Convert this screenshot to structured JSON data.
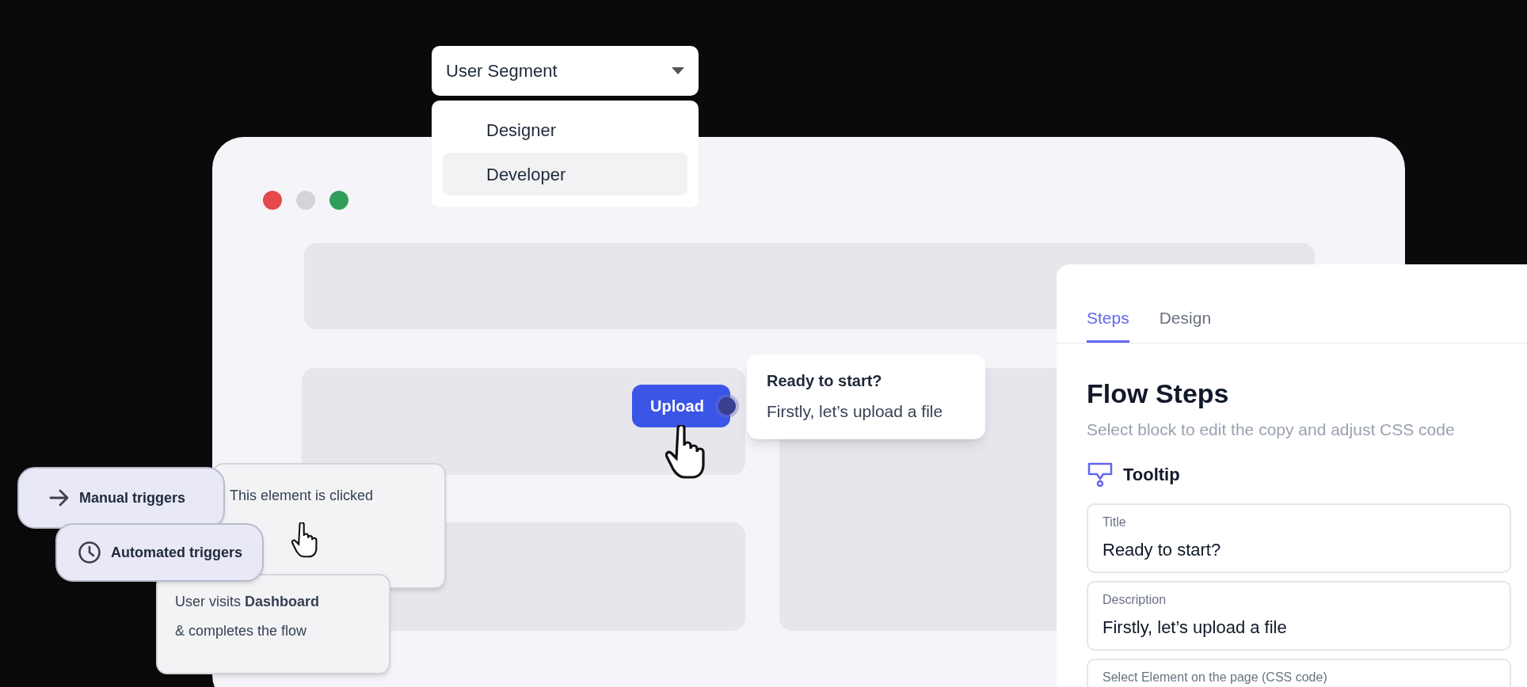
{
  "segment_dropdown": {
    "label": "User Segment",
    "options": [
      {
        "label": "Designer",
        "selected": false
      },
      {
        "label": "Developer",
        "selected": true
      }
    ]
  },
  "browser_window": {
    "controls": [
      {
        "color": "#e5484d"
      },
      {
        "color": "#d4d4d8"
      },
      {
        "color": "#2f9e5a"
      }
    ]
  },
  "upload_button": {
    "label": "Upload"
  },
  "tooltip": {
    "title": "Ready to start?",
    "description": "Firstly, let’s upload a file"
  },
  "trigger_cards": [
    {
      "lines": [
        "This element is clicked"
      ]
    },
    {
      "lines": [
        "User visits **Dashboard**",
        "& completes the flow"
      ]
    }
  ],
  "triggers": [
    {
      "kind": "manual",
      "label": "Manual triggers"
    },
    {
      "kind": "automated",
      "label": "Automated triggers"
    }
  ],
  "panel": {
    "tabs": [
      {
        "label": "Steps",
        "selected": true
      },
      {
        "label": "Design",
        "selected": false
      }
    ],
    "heading": "Flow Steps",
    "subtitle": "Select block to edit the copy and adjust CSS code",
    "block": {
      "label": "Tooltip"
    },
    "fields": [
      {
        "label": "Title",
        "value": "Ready to start?"
      },
      {
        "label": "Description",
        "value": "Firstly, let’s upload a file"
      },
      {
        "label": "Select Element on the page (CSS code)"
      }
    ]
  }
}
